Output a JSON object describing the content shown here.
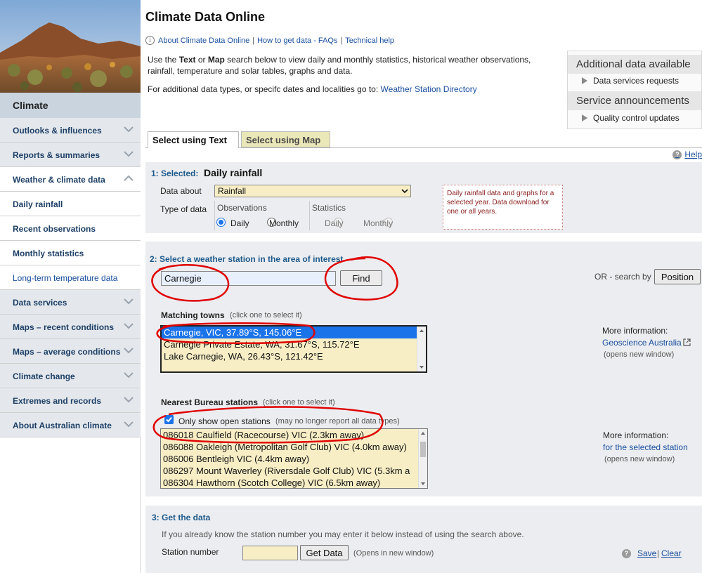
{
  "page": {
    "title": "Climate Data Online",
    "top_links": [
      "About Climate Data Online",
      "How to get data - FAQs",
      "Technical help"
    ],
    "intro_line1_a": "Use the ",
    "intro_text": "Text",
    "intro_line1_b": " or ",
    "intro_map": "Map",
    "intro_line1_c": " search below to view daily and monthly statistics, historical weather observations, rainfall, temperature and solar tables, graphs and data.",
    "intro2_text": "For additional data types, or specifc dates and localities go to: ",
    "intro2_link": "Weather Station Directory"
  },
  "sidebar": {
    "heading": "Climate",
    "items": [
      {
        "label": "Outlooks & influences"
      },
      {
        "label": "Reports & summaries"
      },
      {
        "label": "Weather & climate data"
      },
      {
        "label": "Daily rainfall"
      },
      {
        "label": "Recent observations"
      },
      {
        "label": "Monthly statistics"
      },
      {
        "label": "Long-term temperature data"
      },
      {
        "label": "Data services"
      },
      {
        "label": "Maps – recent conditions"
      },
      {
        "label": "Maps – average conditions"
      },
      {
        "label": "Climate change"
      },
      {
        "label": "Extremes and records"
      },
      {
        "label": "About Australian climate"
      }
    ]
  },
  "right_box": {
    "heading1": "Additional data available",
    "item1": "Data services requests",
    "heading2": "Service announcements",
    "item2": "Quality control updates"
  },
  "tabs": {
    "text": "Select using Text",
    "map": "Select using Map",
    "help": "Help"
  },
  "step1": {
    "num": "1:",
    "label": "Selected:",
    "value": "Daily rainfall",
    "data_about_label": "Data about",
    "data_about_value": "Rainfall",
    "type_label": "Type of data",
    "observations": "Observations",
    "statistics": "Statistics",
    "daily": "Daily",
    "monthly": "Monthly",
    "note": "Daily rainfall data and graphs for a selected year. Data download for one or all years."
  },
  "step2": {
    "heading": "2:  Select a weather station in the area of interest",
    "search_value": "Carnegie",
    "find_label": "Find",
    "or_search": "OR - search by",
    "position_label": "Position",
    "matching_label": "Matching towns",
    "matching_hint": "(click one to select it)",
    "towns": [
      "Carnegie, VIC, 37.89°S, 145.06°E",
      "Carnegie Private Estate, WA, 31.67°S, 115.72°E",
      "Lake Carnegie, WA, 26.43°S, 121.42°E"
    ],
    "more_info1": "More information:",
    "geo_link": "Geoscience Australia",
    "opens_new1": "(opens new window)",
    "nearest_label": "Nearest Bureau stations",
    "nearest_hint": "(click one to select it)",
    "only_open": "Only show open stations",
    "only_open_hint": "(may no longer report all data types)",
    "stations": [
      "086018 Caulfield (Racecourse) VIC (2.3km away)",
      "086088 Oakleigh (Metropolitan Golf Club) VIC (4.0km away)",
      "086006 Bentleigh VIC (4.4km away)",
      "086297 Mount Waverley (Riversdale Golf Club) VIC (5.3km a",
      "086304 Hawthorn (Scotch College) VIC (6.5km away)"
    ],
    "more_info2": "More information:",
    "station_link": "for the selected station",
    "opens_new2": "(opens new window)"
  },
  "step3": {
    "heading": "3:   Get the data",
    "hint": "If you already know the station number you may enter it below instead of using the search above.",
    "station_label": "Station number",
    "get_data_label": "Get Data",
    "opens_hint": "(Opens in new window)",
    "save": "Save",
    "clear": "Clear"
  },
  "colors": {
    "annotation": "#e00000",
    "selection": "#1a73e8",
    "field_bg": "#f7eec6"
  }
}
